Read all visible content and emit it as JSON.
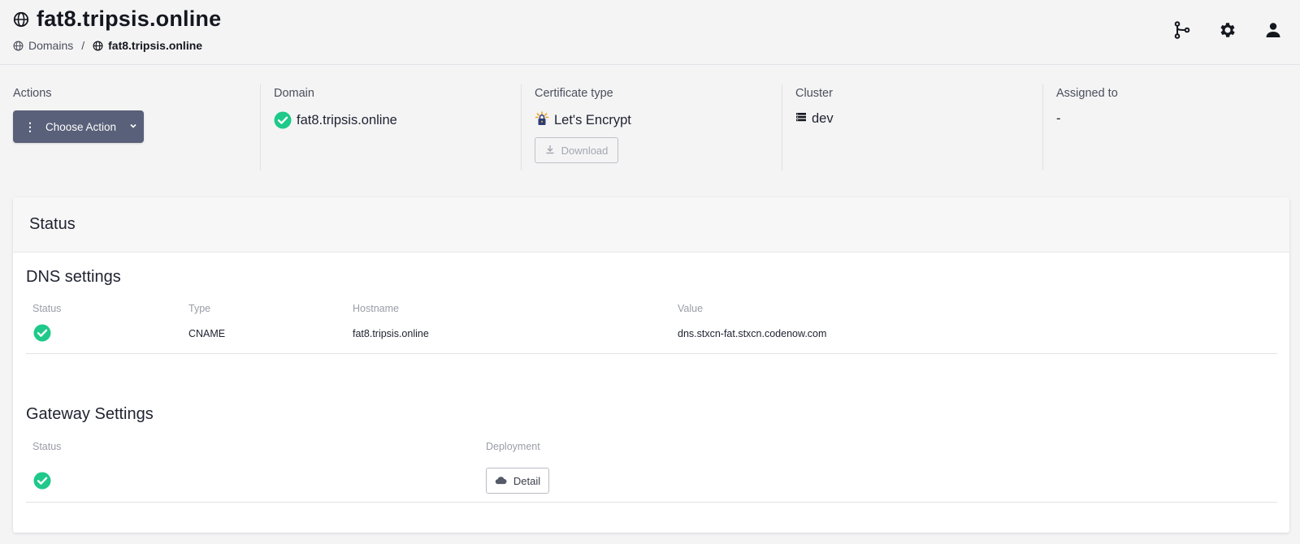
{
  "header": {
    "title": "fat8.tripsis.online",
    "breadcrumb": {
      "root": "Domains",
      "separator": "/",
      "current": "fat8.tripsis.online"
    },
    "icons": [
      "git-branch-icon",
      "gear-icon",
      "user-icon"
    ]
  },
  "info": {
    "actions": {
      "label": "Actions",
      "button": "Choose Action"
    },
    "domain": {
      "label": "Domain",
      "value": "fat8.tripsis.online"
    },
    "certificate": {
      "label": "Certificate type",
      "value": "Let's Encrypt",
      "download": "Download"
    },
    "cluster": {
      "label": "Cluster",
      "value": "dev"
    },
    "assigned": {
      "label": "Assigned to",
      "value": "-"
    }
  },
  "status_card": {
    "title": "Status",
    "dns": {
      "title": "DNS settings",
      "columns": [
        "Status",
        "Type",
        "Hostname",
        "Value"
      ],
      "rows": [
        {
          "status": "ok",
          "type": "CNAME",
          "hostname": "fat8.tripsis.online",
          "value": "dns.stxcn-fat.stxcn.codenow.com"
        }
      ]
    },
    "gateway": {
      "title": "Gateway Settings",
      "columns": [
        "Status",
        "Deployment"
      ],
      "rows": [
        {
          "status": "ok",
          "deployment_button": "Detail"
        }
      ]
    }
  },
  "colors": {
    "success": "#1ec98a",
    "action_button": "#596079",
    "background": "#f4f4f5"
  }
}
